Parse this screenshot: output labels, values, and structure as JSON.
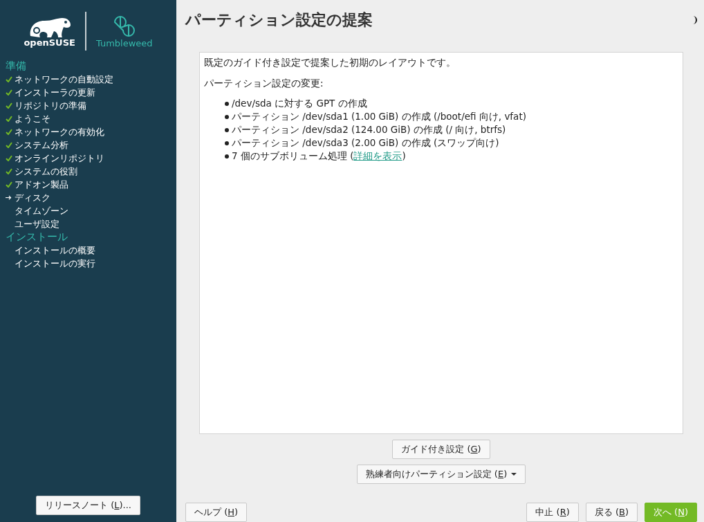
{
  "logo": {
    "brand": "openSUSE",
    "product": "Tumbleweed"
  },
  "steps": [
    {
      "title": "準備",
      "items": [
        {
          "label": "ネットワークの自動設定",
          "kind": "done"
        },
        {
          "label": "インストーラの更新",
          "kind": "done"
        },
        {
          "label": "リポジトリの準備",
          "kind": "done"
        },
        {
          "label": "ようこそ",
          "kind": "done"
        },
        {
          "label": "ネットワークの有効化",
          "kind": "done"
        },
        {
          "label": "システム分析",
          "kind": "done"
        },
        {
          "label": "オンラインリポジトリ",
          "kind": "done"
        },
        {
          "label": "システムの役割",
          "kind": "done"
        },
        {
          "label": "アドオン製品",
          "kind": "done"
        },
        {
          "label": "ディスク",
          "kind": "current"
        },
        {
          "label": "タイムゾーン",
          "kind": "pending"
        },
        {
          "label": "ユーザ設定",
          "kind": "pending"
        }
      ]
    },
    {
      "title": "インストール",
      "items": [
        {
          "label": "インストールの概要",
          "kind": "pending"
        },
        {
          "label": "インストールの実行",
          "kind": "pending"
        }
      ]
    }
  ],
  "release_notes_button": {
    "before": "リリースノート (",
    "mnemonic": "L",
    "after": ")..."
  },
  "page": {
    "title": "パーティション設定の提案"
  },
  "proposal": {
    "intro": "既定のガイド付き設定で提案した初期のレイアウトです。",
    "heading": "パーティション設定の変更:",
    "changes": [
      {
        "text": "/dev/sda に対する GPT の作成"
      },
      {
        "text": "パーティション /dev/sda1 (1.00 GiB) の作成 (/boot/efi 向け, vfat)"
      },
      {
        "text": "パーティション /dev/sda2 (124.00 GiB) の作成 (/ 向け, btrfs)"
      },
      {
        "text": "パーティション /dev/sda3 (2.00 GiB) の作成 (スワップ向け)"
      },
      {
        "text": "7 個のサブボリューム処理 (",
        "link": "詳細を表示",
        "after": ")"
      }
    ]
  },
  "guided_button": {
    "before": "ガイド付き設定 (",
    "mnemonic": "G",
    "after": ")"
  },
  "expert_button": {
    "before": "熟練者向けパーティション設定 (",
    "mnemonic": "E",
    "after": ")"
  },
  "footer": [
    {
      "before": "ヘルプ (",
      "mnemonic": "H",
      "after": ")",
      "kind": "plain"
    },
    {
      "before": "中止 (",
      "mnemonic": "R",
      "after": ")",
      "kind": "plain"
    },
    {
      "before": "戻る (",
      "mnemonic": "B",
      "after": ")",
      "kind": "plain"
    },
    {
      "before": "次へ (",
      "mnemonic": "N",
      "after": ")",
      "kind": "primary"
    }
  ]
}
